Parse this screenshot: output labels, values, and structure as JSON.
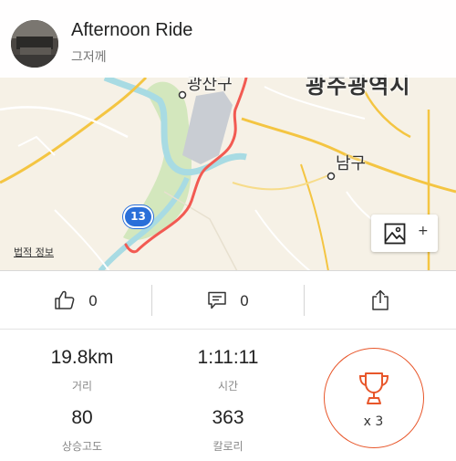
{
  "header": {
    "title": "Afternoon Ride",
    "date": "그저께"
  },
  "map": {
    "labels": {
      "gwangsan": "광산구",
      "gwangju": "광주광역시",
      "namgu": "남구"
    },
    "route_shield": "13",
    "legal_link": "법적 정보",
    "photo_button_plus": "+",
    "colors": {
      "route": "#f25a52",
      "river": "#a8dbe3",
      "park": "#cfe6b8",
      "road": "#f4c542",
      "land": "#f6f1e6"
    }
  },
  "actions": {
    "kudos_count": "0",
    "comments_count": "0",
    "icons": [
      "thumbs-up-icon",
      "comment-icon",
      "share-icon"
    ]
  },
  "stats": {
    "distance": {
      "value": "19.8km",
      "label": "거리"
    },
    "time": {
      "value": "1:11:11",
      "label": "시간"
    },
    "elevation": {
      "value": "80",
      "label": "상승고도"
    },
    "calories": {
      "value": "363",
      "label": "칼로리"
    },
    "achievements": "x 3"
  },
  "accent_color": "#e8562a"
}
